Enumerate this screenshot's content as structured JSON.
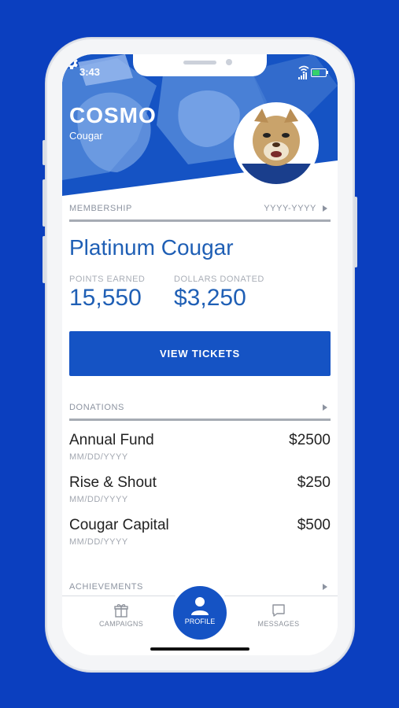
{
  "status": {
    "time": "3:43"
  },
  "profile": {
    "name": "COSMO",
    "subtitle": "Cougar"
  },
  "membership": {
    "section_label": "MEMBERSHIP",
    "range_label": "YYYY-YYYY",
    "tier": "Platinum Cougar",
    "points_label": "POINTS EARNED",
    "points_value": "15,550",
    "dollars_label": "DOLLARS DONATED",
    "dollars_value": "$3,250"
  },
  "tickets_button": "VIEW TICKETS",
  "donations": {
    "section_label": "DONATIONS",
    "items": [
      {
        "name": "Annual Fund",
        "date": "MM/DD/YYYY",
        "amount": "$2500"
      },
      {
        "name": "Rise & Shout",
        "date": "MM/DD/YYYY",
        "amount": "$250"
      },
      {
        "name": "Cougar Capital",
        "date": "MM/DD/YYYY",
        "amount": "$500"
      }
    ]
  },
  "achievements": {
    "section_label": "ACHIEVEMENTS"
  },
  "tabs": {
    "campaigns": "CAMPAIGNS",
    "profile": "PROFILE",
    "messages": "MESSAGES"
  },
  "colors": {
    "brand_blue": "#1553c4",
    "background": "#0b3fbf",
    "accent_text": "#1f5fb5"
  },
  "icons": [
    "gear-icon",
    "gift-icon",
    "person-icon",
    "chat-icon",
    "chevron-right-icon",
    "wifi-icon",
    "battery-icon",
    "signal-icon"
  ]
}
